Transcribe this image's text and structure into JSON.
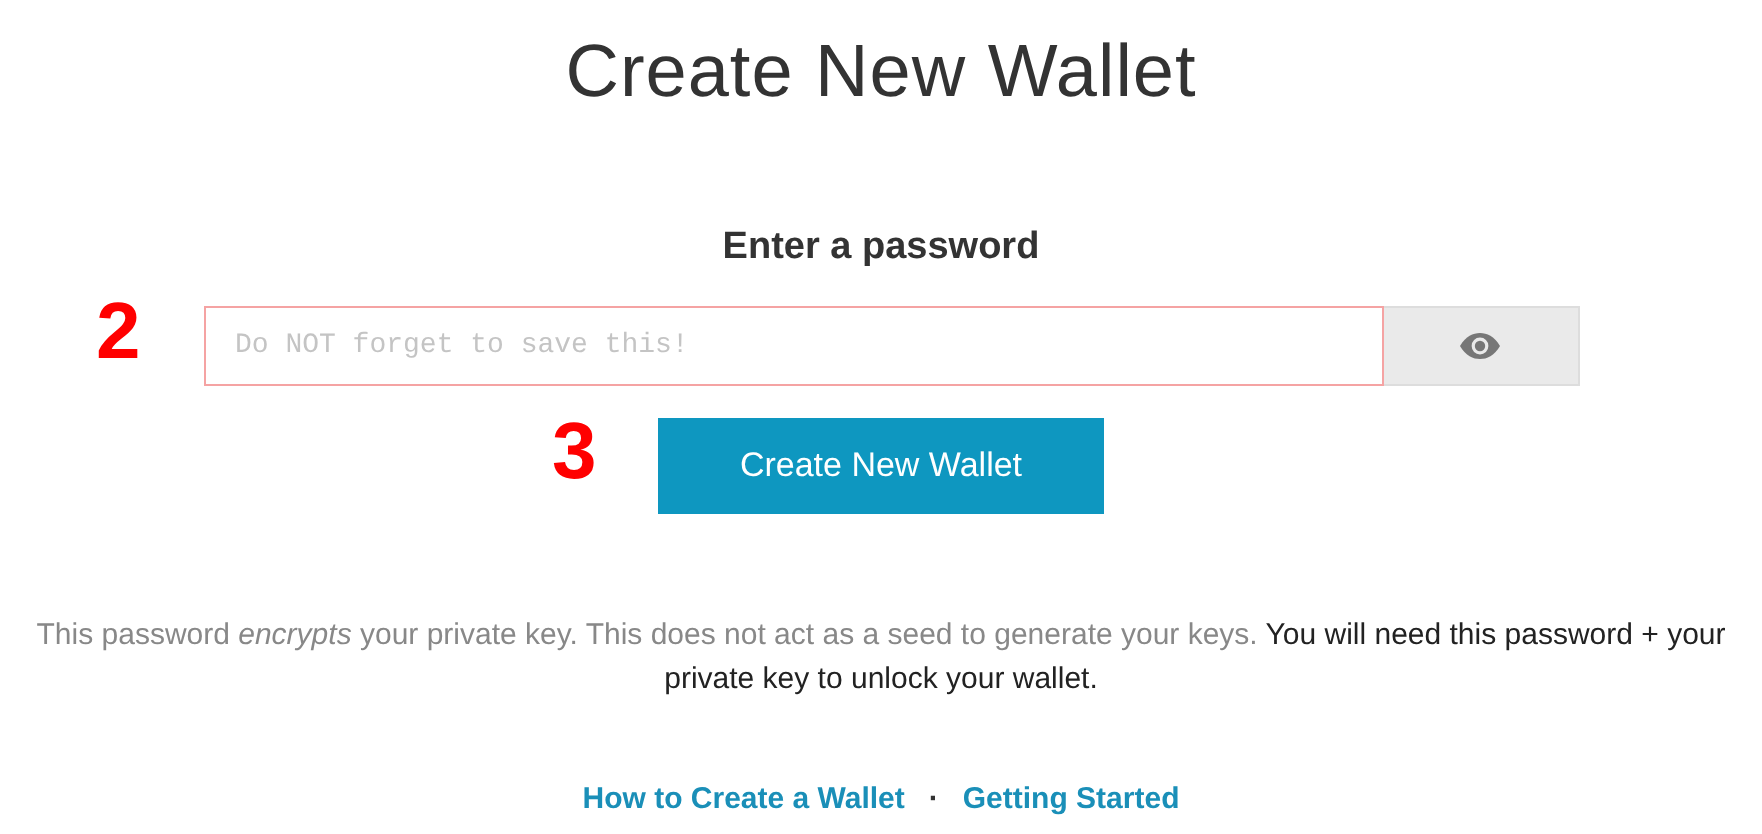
{
  "title": "Create New Wallet",
  "password": {
    "label": "Enter a password",
    "placeholder": "Do NOT forget to save this!",
    "annotation": "2"
  },
  "create_button": {
    "label": "Create New Wallet",
    "annotation": "3"
  },
  "note": "This password *encrypts* your private key. This does not act as a seed to generate your keys. **You will need this password + your private key to unlock your wallet.**",
  "links": [
    {
      "label": "How to Create a Wallet"
    },
    {
      "label": "Getting Started"
    }
  ],
  "link_separator": "·"
}
